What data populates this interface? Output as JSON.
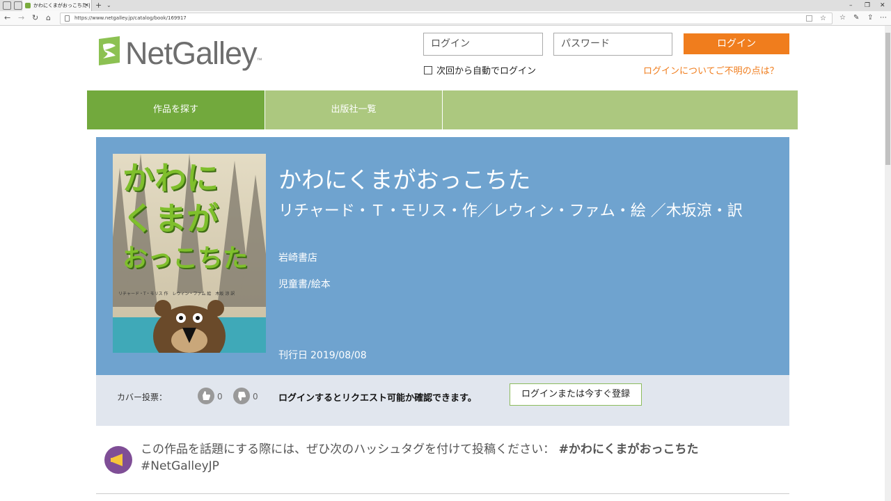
{
  "browser": {
    "tab_title": "かわにくまがおっこちた | リチ",
    "url": "https://www.netgalley.jp/catalog/book/169917"
  },
  "header": {
    "logo_text": "NetGalley",
    "logo_tm": "™",
    "login_placeholder": "ログイン",
    "password_placeholder": "パスワード",
    "login_button": "ログイン",
    "remember_label": "次回から自動でログイン",
    "help_link": "ログインについてご不明の点は？"
  },
  "nav": {
    "items": [
      {
        "label": "作品を探す"
      },
      {
        "label": "出版社一覧"
      }
    ]
  },
  "book": {
    "title": "かわにくまがおっこちた",
    "author": "リチャード・Ｔ・モリス・作／レウィン・ファム・絵 ／木坂涼・訳",
    "publisher": "岩崎書店",
    "category": "児童書/絵本",
    "date_label": "刊行日",
    "date_value": "2019/08/08",
    "cover": {
      "title_lines": [
        "かわに",
        "くまが",
        "おっこちた"
      ],
      "credits": "リチャード・T・モリス 作　レウィン・ファム 絵　木坂 涼 訳"
    }
  },
  "vote": {
    "label": "カバー投票：",
    "up_count": "0",
    "down_count": "0",
    "message": "ログインするとリクエスト可能か確認できます。",
    "button": "ログインまたは今すぐ登録"
  },
  "hashtag": {
    "text": "この作品を話題にする際には、ぜひ次のハッシュタグを付けて投稿ください：",
    "tag1": "#かわにくまがおっこちた",
    "tag2": "#NetGalleyJP"
  },
  "colors": {
    "brand_green": "#72a93d",
    "nav_light_green": "#acc87f",
    "orange": "#f07d1d",
    "book_blue": "#6fa3cf",
    "vote_bg": "#e1e6ee",
    "hashtag_purple": "#7f4e96"
  }
}
